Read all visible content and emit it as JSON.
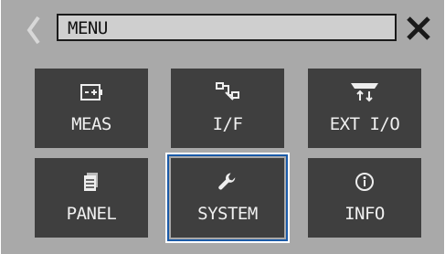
{
  "header": {
    "title": "MENU",
    "back_icon": "chevron-left-icon",
    "close_icon": "close-icon"
  },
  "menu": {
    "items": [
      {
        "label": "MEAS",
        "icon": "battery-icon"
      },
      {
        "label": "I/F",
        "icon": "connection-icon"
      },
      {
        "label": "EXT I/O",
        "icon": "connector-icon"
      },
      {
        "label": "PANEL",
        "icon": "panel-icon"
      },
      {
        "label": "SYSTEM",
        "icon": "wrench-icon",
        "selected": true
      },
      {
        "label": "INFO",
        "icon": "info-icon"
      }
    ]
  },
  "colors": {
    "background": "#a9a9a9",
    "tile": "#3f3f3f",
    "selection": "#1a5aa8"
  }
}
